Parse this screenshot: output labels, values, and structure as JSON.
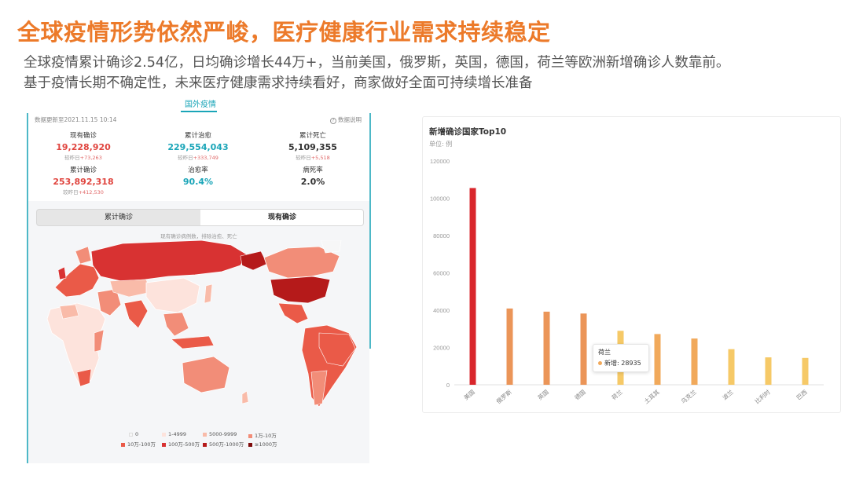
{
  "slide": {
    "title": "全球疫情形势依然严峻，医疗健康行业需求持续稳定",
    "subtitle_line1": "全球疫情累计确诊2.54亿，日均确诊增长44万+，当前美国，俄罗斯，英国，德国，荷兰等欧洲新增确诊人数靠前。",
    "subtitle_line2": "基于疫情长期不确定性，未来医疗健康需求持续看好，商家做好全面可持续增长准备"
  },
  "dashboard": {
    "tab": "国外疫情",
    "update_time": "数据更新至2021.11.15 10:14",
    "data_note": "数据说明",
    "stats": [
      {
        "label": "现有确诊",
        "value": "19,228,920",
        "delta_prefix": "较昨日",
        "delta": "+73,263"
      },
      {
        "label": "累计治愈",
        "value": "229,554,043",
        "delta_prefix": "较昨日",
        "delta": "+333,749"
      },
      {
        "label": "累计死亡",
        "value": "5,109,355",
        "delta_prefix": "较昨日",
        "delta": "+5,518"
      },
      {
        "label": "累计确诊",
        "value": "253,892,318",
        "delta_prefix": "较昨日",
        "delta": "+412,530"
      },
      {
        "label": "治愈率",
        "value": "90.4%"
      },
      {
        "label": "病死率",
        "value": "2.0%"
      }
    ],
    "toggle": {
      "option_a": "累计确诊",
      "option_b": "现有确诊"
    },
    "map_note": "现有确诊病例数，排除治愈、死亡",
    "legend": [
      {
        "label": "0",
        "color": "#f7f7f7"
      },
      {
        "label": "1-4999",
        "color": "#fde3dc"
      },
      {
        "label": "5000-9999",
        "color": "#f9bba9"
      },
      {
        "label": "1万-10万",
        "color": "#f28d78"
      },
      {
        "label": "10万-100万",
        "color": "#ea5a48"
      },
      {
        "label": "100万-500万",
        "color": "#d83232"
      },
      {
        "label": "500万-1000万",
        "color": "#b51a1a"
      },
      {
        "label": "≥1000万",
        "color": "#7e0c0c"
      }
    ]
  },
  "chart_data": {
    "type": "bar",
    "title": "新增确诊国家Top10",
    "unit_label": "单位: 例",
    "categories": [
      "美国",
      "俄罗斯",
      "英国",
      "德国",
      "荷兰",
      "土耳其",
      "乌克兰",
      "波兰",
      "比利时",
      "巴西"
    ],
    "values": [
      105500,
      40900,
      39200,
      38200,
      28935,
      27200,
      24800,
      19100,
      14700,
      14400
    ],
    "colors": [
      "#d9262c",
      "#eb9558",
      "#eb9558",
      "#eb9558",
      "#f6c967",
      "#f1a95b",
      "#f1a95b",
      "#f6c967",
      "#f6c967",
      "#f6c967"
    ],
    "ylim": [
      0,
      120000
    ],
    "yticks": [
      0,
      20000,
      40000,
      60000,
      80000,
      100000,
      120000
    ],
    "grid": false,
    "tooltip": {
      "category": "荷兰",
      "series_label": "新增",
      "value": "28935"
    }
  }
}
